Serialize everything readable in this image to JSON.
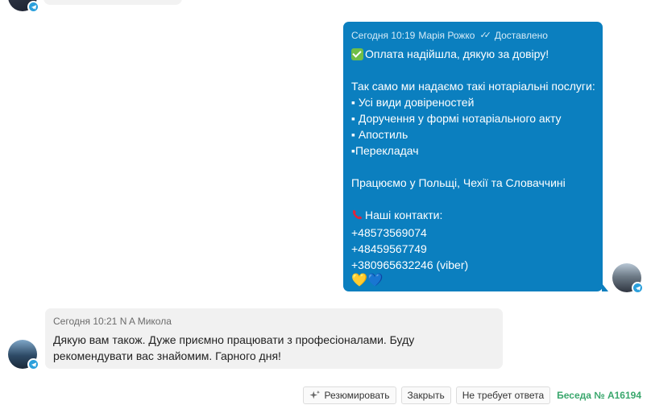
{
  "outgoing_message": {
    "date": "Сегодня 10:19",
    "author": "Марія Рожко",
    "status": "Доставлено",
    "lines": [
      "Оплата надійшла, дякую за довіру!",
      "",
      "Так само ми надаємо такі нотаріальні послуги:",
      "▪ Усі види довіреностей",
      "▪ Доручення у формі нотаріального акту",
      "▪ Апостиль",
      "▪Перекладач",
      "",
      "Працюємо у Польщі, Чехії та Словаччині",
      "",
      "Наші контакти:",
      "+48573569074",
      "+48459567749",
      "+380965632246 (viber)"
    ],
    "hearts": [
      "💛",
      "💙"
    ]
  },
  "incoming_message": {
    "date": "Сегодня 10:21",
    "author": "N A Микола",
    "text": "Дякую вам також. Дуже приємно працювати з професіоналами. Буду рекомендувати вас знайомим. Гарного дня!"
  },
  "toolbar": {
    "summarize_label": "Резюмировать",
    "close_label": "Закрыть",
    "no_reply_label": "Не требует ответа",
    "conversation_id": "Беседа № A16194"
  },
  "colors": {
    "outgoing_bubble": "#0b7fbf",
    "incoming_bubble": "#f1f1f1",
    "telegram_badge": "#2ba0dc",
    "conversation_id": "#3aa76d"
  },
  "icons": {
    "check_emoji": "check-mark-emoji-icon",
    "phone_emoji": "telephone-receiver-emoji-icon",
    "summarize": "sparkles-icon",
    "channel": "telegram-icon"
  }
}
